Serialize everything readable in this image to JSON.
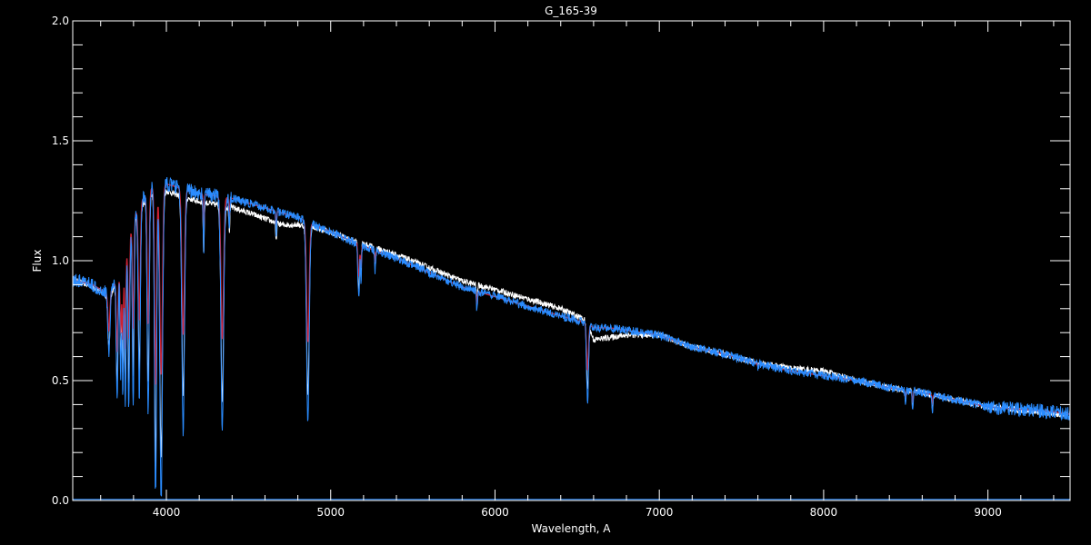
{
  "chart_data": {
    "type": "line",
    "title": "G_165-39",
    "xlabel": "Wavelength, A",
    "ylabel": "Flux",
    "xlim": [
      3430,
      9500
    ],
    "ylim": [
      0.0,
      2.0
    ],
    "x_ticks": [
      4000,
      5000,
      6000,
      7000,
      8000,
      9000
    ],
    "x_tick_labels": [
      "4000",
      "5000",
      "6000",
      "7000",
      "8000",
      "9000"
    ],
    "y_ticks": [
      0.0,
      0.5,
      1.0,
      1.5,
      2.0
    ],
    "y_tick_labels": [
      "0.0",
      "0.5",
      "1.0",
      "1.5",
      "2.0"
    ],
    "grid": false,
    "background": "#000000",
    "colors": {
      "observed": "#ffffff",
      "model": "#cc2233",
      "fit": "#2a8cff",
      "axes": "#ffffff"
    },
    "continuum": {
      "x": [
        3430,
        3550,
        3650,
        3720,
        3800,
        3850,
        3900,
        3950,
        4000,
        4100,
        4200,
        4300,
        4400,
        4500,
        4600,
        4700,
        4800,
        4900,
        5000,
        5200,
        5400,
        5600,
        5800,
        6000,
        6200,
        6400,
        6560,
        6600,
        6700,
        6800,
        7000,
        7200,
        7400,
        7600,
        7800,
        8000,
        8200,
        8400,
        8600,
        8800,
        9000,
        9200,
        9400,
        9500
      ],
      "y": [
        0.92,
        0.9,
        0.86,
        0.95,
        1.18,
        1.25,
        1.3,
        1.31,
        1.32,
        1.3,
        1.28,
        1.27,
        1.26,
        1.24,
        1.22,
        1.2,
        1.18,
        1.15,
        1.12,
        1.06,
        1.01,
        0.95,
        0.89,
        0.85,
        0.81,
        0.77,
        0.74,
        0.72,
        0.72,
        0.71,
        0.69,
        0.64,
        0.61,
        0.57,
        0.54,
        0.52,
        0.5,
        0.47,
        0.45,
        0.42,
        0.39,
        0.38,
        0.37,
        0.36
      ]
    },
    "observed_offsets": {
      "x": [
        3430,
        4000,
        4500,
        4700,
        4900,
        5200,
        5600,
        6000,
        6400,
        6560,
        6600,
        6700,
        6800,
        7000,
        7500,
        8000,
        8200,
        8400,
        9000,
        9500
      ],
      "dy": [
        0.0,
        -0.03,
        -0.04,
        -0.05,
        -0.01,
        0.01,
        0.02,
        0.03,
        0.03,
        0.01,
        -0.05,
        -0.04,
        -0.02,
        0.0,
        0.0,
        0.02,
        0.0,
        0.0,
        0.0,
        -0.01
      ]
    },
    "absorption_lines": [
      {
        "x": 3650,
        "depth": 0.3,
        "width": 6
      },
      {
        "x": 3700,
        "depth": 0.55,
        "width": 5
      },
      {
        "x": 3722,
        "depth": 0.45,
        "width": 4
      },
      {
        "x": 3735,
        "depth": 0.55,
        "width": 4
      },
      {
        "x": 3750,
        "depth": 0.65,
        "width": 4
      },
      {
        "x": 3771,
        "depth": 0.65,
        "width": 5
      },
      {
        "x": 3798,
        "depth": 0.65,
        "width": 5
      },
      {
        "x": 3835,
        "depth": 0.65,
        "width": 6
      },
      {
        "x": 3889,
        "depth": 0.72,
        "width": 6
      },
      {
        "x": 3934,
        "depth": 1.05,
        "width": 6
      },
      {
        "x": 3968,
        "depth": 1.0,
        "width": 8
      },
      {
        "x": 4102,
        "depth": 0.78,
        "width": 8
      },
      {
        "x": 4227,
        "depth": 0.2,
        "width": 3
      },
      {
        "x": 4340,
        "depth": 0.78,
        "width": 8
      },
      {
        "x": 4383,
        "depth": 0.1,
        "width": 3
      },
      {
        "x": 4668,
        "depth": 0.08,
        "width": 3
      },
      {
        "x": 4861,
        "depth": 0.72,
        "width": 8
      },
      {
        "x": 5167,
        "depth": 0.15,
        "width": 3
      },
      {
        "x": 5173,
        "depth": 0.18,
        "width": 3
      },
      {
        "x": 5184,
        "depth": 0.15,
        "width": 3
      },
      {
        "x": 5270,
        "depth": 0.08,
        "width": 3
      },
      {
        "x": 5890,
        "depth": 0.1,
        "width": 3
      },
      {
        "x": 6563,
        "depth": 0.44,
        "width": 6
      },
      {
        "x": 7600,
        "depth": 0.03,
        "width": 4
      },
      {
        "x": 8498,
        "depth": 0.12,
        "width": 3
      },
      {
        "x": 8542,
        "depth": 0.18,
        "width": 3
      },
      {
        "x": 8662,
        "depth": 0.16,
        "width": 3
      }
    ],
    "error_floor": 0.005
  }
}
